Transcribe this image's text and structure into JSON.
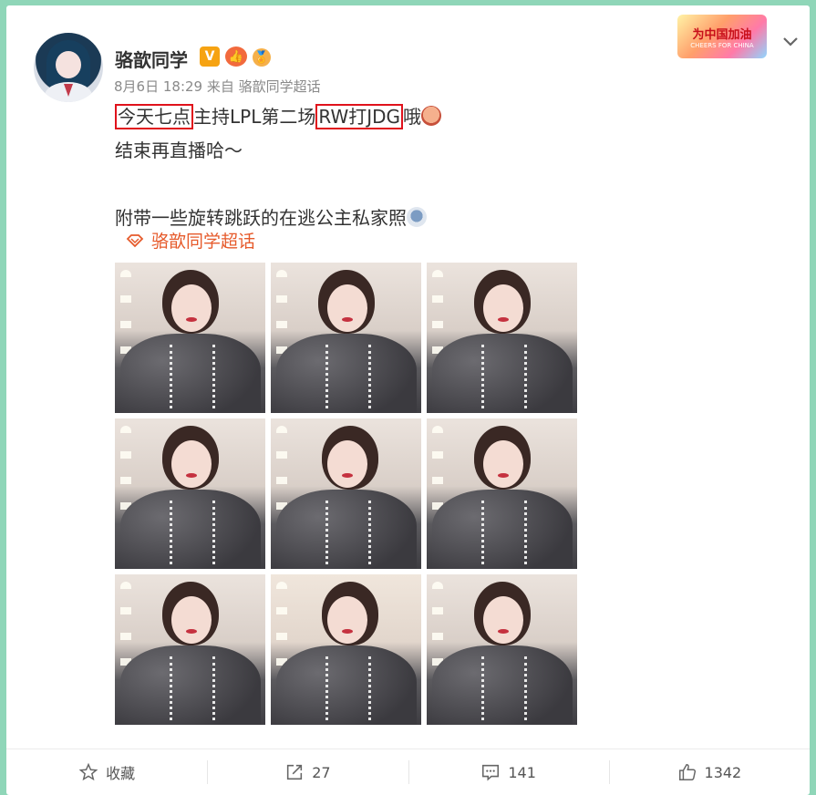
{
  "user": {
    "name": "骆歆同学",
    "verified_badge": "V",
    "rank_badge": "👍",
    "medal_badge": "🏅"
  },
  "meta": {
    "date": "8月6日 18:29",
    "source": "来自 骆歆同学超话"
  },
  "event_badge": {
    "title": "为中国加油",
    "subtitle": "CHEERS FOR CHINA"
  },
  "post": {
    "line1_part1": "今天七点",
    "line1_part2": "主持LPL第二场",
    "line1_part3": "RW打JDG",
    "line1_part4": "哦",
    "line2": "结束再直播哈～",
    "line3": "附带一些旋转跳跃的在逃公主私家照",
    "highlight_color": "#e0121c"
  },
  "topic": {
    "label": "骆歆同学超话",
    "icon": "diamond-topic-icon",
    "color": "#e65a2b"
  },
  "photos": {
    "count": 9
  },
  "actions": {
    "favorite_label": "收藏",
    "repost_count": "27",
    "comment_count": "141",
    "like_count": "1342"
  },
  "colors": {
    "background": "#8fd6b8",
    "text": "#333333",
    "meta": "#8a8a8a"
  }
}
